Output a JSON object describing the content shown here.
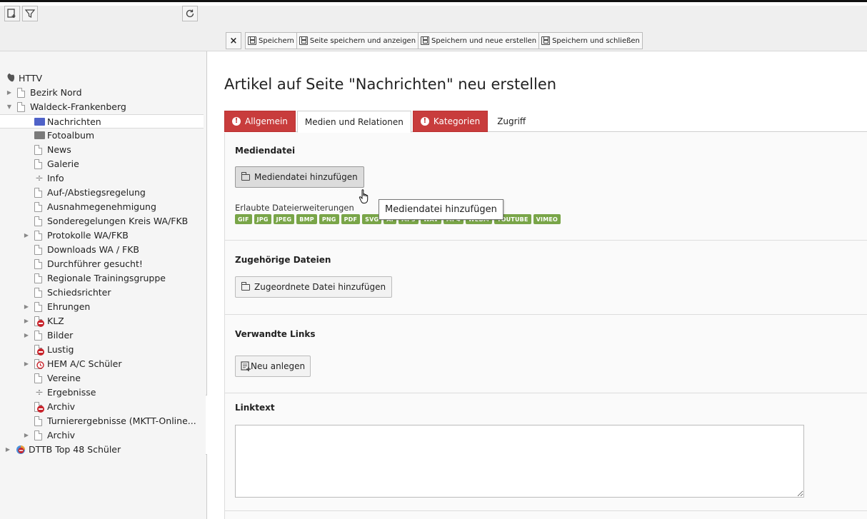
{
  "tree": {
    "items": [
      {
        "label": "HTTV",
        "type": "root"
      },
      {
        "label": "Bezirk Nord",
        "type": "page"
      },
      {
        "label": "Waldeck-Frankenberg",
        "type": "page"
      },
      {
        "label": "Nachrichten",
        "type": "folder-blue"
      },
      {
        "label": "Fotoalbum",
        "type": "folder"
      },
      {
        "label": "News",
        "type": "page"
      },
      {
        "label": "Galerie",
        "type": "page"
      },
      {
        "label": "Info",
        "type": "divider"
      },
      {
        "label": "Auf-/Abstiegsregelung",
        "type": "page"
      },
      {
        "label": "Ausnahmegenehmigung",
        "type": "page"
      },
      {
        "label": "Sonderegelungen Kreis WA/FKB",
        "type": "page"
      },
      {
        "label": "Protokolle WA/FKB",
        "type": "page"
      },
      {
        "label": "Downloads WA / FKB",
        "type": "page"
      },
      {
        "label": "Durchführer gesucht!",
        "type": "page"
      },
      {
        "label": "Regionale Trainingsgruppe",
        "type": "page"
      },
      {
        "label": "Schiedsrichter",
        "type": "page"
      },
      {
        "label": "Ehrungen",
        "type": "page"
      },
      {
        "label": "KLZ",
        "type": "hidden"
      },
      {
        "label": "Bilder",
        "type": "page"
      },
      {
        "label": "Lustig",
        "type": "hidden"
      },
      {
        "label": "HEM A/C Schüler",
        "type": "timed"
      },
      {
        "label": "Vereine",
        "type": "page"
      },
      {
        "label": "Ergebnisse",
        "type": "divider"
      },
      {
        "label": "Archiv",
        "type": "hidden"
      },
      {
        "label": "Turnierergebnisse (MKTT-Online...",
        "type": "page"
      },
      {
        "label": "Archiv",
        "type": "page"
      },
      {
        "label": "DTTB Top 48 Schüler",
        "type": "hidden-colored"
      }
    ]
  },
  "toolbar": {
    "close_label": "×",
    "save_label": "Speichern",
    "save_view_label": "Seite speichern und anzeigen",
    "save_new_label": "Speichern und neue erstellen",
    "save_close_label": "Speichern und schließen"
  },
  "page_title": "Artikel auf Seite \"Nachrichten\" neu erstellen",
  "tabs": [
    {
      "label": "Allgemein",
      "state": "error"
    },
    {
      "label": "Medien und Relationen",
      "state": "active"
    },
    {
      "label": "Kategorien",
      "state": "error"
    },
    {
      "label": "Zugriff",
      "state": "plain"
    }
  ],
  "media": {
    "title": "Mediendatei",
    "add_button": "Mediendatei hinzufügen",
    "allowed_label": "Erlaubte Dateierweiterungen",
    "extensions": [
      "GIF",
      "JPG",
      "JPEG",
      "BMP",
      "PNG",
      "PDF",
      "SVG",
      "AI",
      "MP3",
      "WAV",
      "MP4",
      "WEBM",
      "YOUTUBE",
      "VIMEO"
    ],
    "tooltip": "Mediendatei hinzufügen"
  },
  "related_files": {
    "title": "Zugehörige Dateien",
    "add_button": "Zugeordnete Datei hinzufügen"
  },
  "related_links": {
    "title": "Verwandte Links",
    "new_button": "Neu anlegen"
  },
  "linktext": {
    "title": "Linktext",
    "value": ""
  }
}
